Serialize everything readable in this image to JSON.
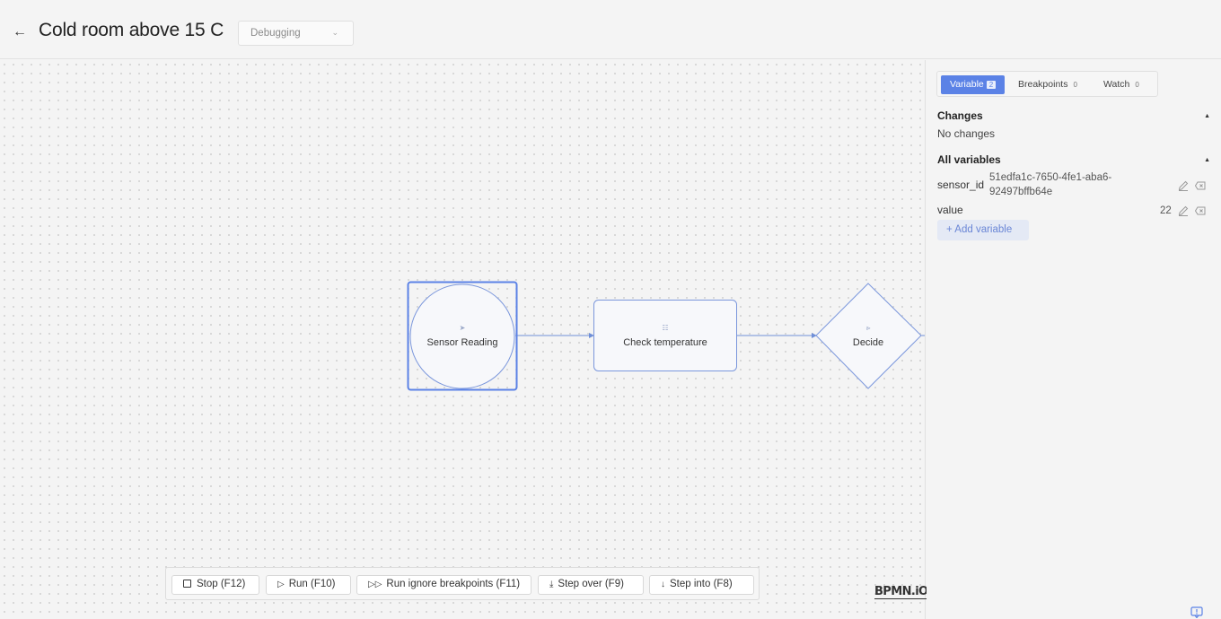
{
  "header": {
    "back_icon": "arrow-left-icon",
    "title": "Cold room above 15 C",
    "mode_select": "Debugging"
  },
  "diagram": {
    "nodes": [
      {
        "type": "start-event",
        "label": "Sensor Reading",
        "icon": "rocket-icon",
        "selected": true
      },
      {
        "type": "task",
        "label": "Check temperature",
        "icon": "rule-icon"
      },
      {
        "type": "gateway",
        "label": "Decide",
        "icon": "split-icon"
      }
    ],
    "accent_color": "#5b82e6"
  },
  "toolbar": {
    "stop": "Stop (F12)",
    "run": "Run (F10)",
    "run_ignore": "Run ignore breakpoints (F11)",
    "step_over": "Step over (F9)",
    "step_into": "Step into (F8)"
  },
  "logo": "BPMN.iO",
  "panel": {
    "tabs": [
      {
        "label": "Variable",
        "count": "2",
        "active": true
      },
      {
        "label": "Breakpoints",
        "count": "0"
      },
      {
        "label": "Watch",
        "count": "0"
      }
    ],
    "changes_title": "Changes",
    "changes_empty": "No changes",
    "all_vars_title": "All variables",
    "variables": [
      {
        "name": "sensor_id",
        "value_line1": "51edfa1c-7650-4fe1-aba6-",
        "value_line2": "92497bffb64e"
      },
      {
        "name": "value",
        "value": "22"
      }
    ],
    "add_variable": "Add variable"
  }
}
